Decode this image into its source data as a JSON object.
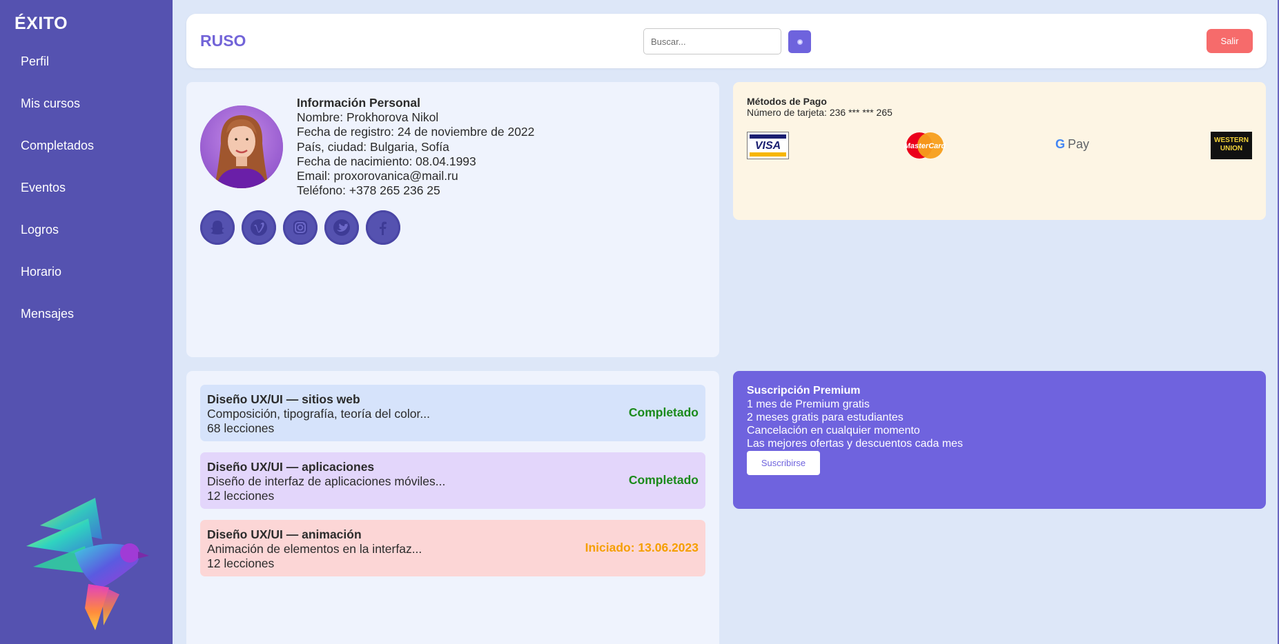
{
  "sidebar": {
    "brand": "ÉXITO",
    "items": [
      {
        "label": "Perfil"
      },
      {
        "label": "Mis cursos"
      },
      {
        "label": "Completados"
      },
      {
        "label": "Eventos"
      },
      {
        "label": "Logros"
      },
      {
        "label": "Horario"
      },
      {
        "label": "Mensajes"
      }
    ],
    "logo_icon": "colorful-bird-logo"
  },
  "header": {
    "title": "RUSO",
    "search": {
      "placeholder": "Buscar...",
      "value": ""
    },
    "search_button_icon": "search-dot-icon",
    "logout_label": "Salir"
  },
  "profile": {
    "heading": "Información Personal",
    "name": "Nombre: Prokhorova Nikol",
    "registered": "Fecha de registro: 24 de noviembre de 2022",
    "location": "País, ciudad: Bulgaria, Sofía",
    "birthdate": "Fecha de nacimiento: 08.04.1993",
    "email": "Email: proxorovanica@mail.ru",
    "phone": "Teléfono: +378 265 236 25",
    "socials": [
      "snapchat-icon",
      "vimeo-icon",
      "instagram-icon",
      "twitter-icon",
      "facebook-icon"
    ]
  },
  "payment": {
    "title": "Métodos de Pago",
    "card_number": "Número de tarjeta: 236 *** *** 265",
    "methods": {
      "visa": "VISA",
      "mastercard": "MasterCard",
      "gpay": "Pay",
      "western_union_line1": "WESTERN",
      "western_union_line2": "UNION"
    }
  },
  "courses": [
    {
      "name": "Diseño UX/UI — sitios web",
      "desc": "Composición, tipografía, teoría del color...",
      "lessons": "68 lecciones",
      "status": "Completado",
      "status_color": "#1a8a1a"
    },
    {
      "name": "Diseño UX/UI — aplicaciones",
      "desc": "Diseño de interfaz de aplicaciones móviles...",
      "lessons": "12 lecciones",
      "status": "Completado",
      "status_color": "#1a8a1a"
    },
    {
      "name": "Diseño UX/UI — animación",
      "desc": "Animación de elementos en la interfaz...",
      "lessons": "12 lecciones",
      "status": "Iniciado: 13.06.2023",
      "status_color": "#f59f00"
    }
  ],
  "premium": {
    "title": "Suscripción Premium",
    "benefits": [
      "1 mes de Premium gratis",
      "2 meses gratis para estudiantes",
      "Cancelación en cualquier momento",
      "Las mejores ofertas y descuentos cada mes"
    ],
    "button": "Suscribirse"
  },
  "colors": {
    "sidebar": "#5552b0",
    "accent": "#6f63de",
    "logout": "#f66b6b",
    "completed": "#1a8a1a",
    "started": "#f59f00"
  }
}
